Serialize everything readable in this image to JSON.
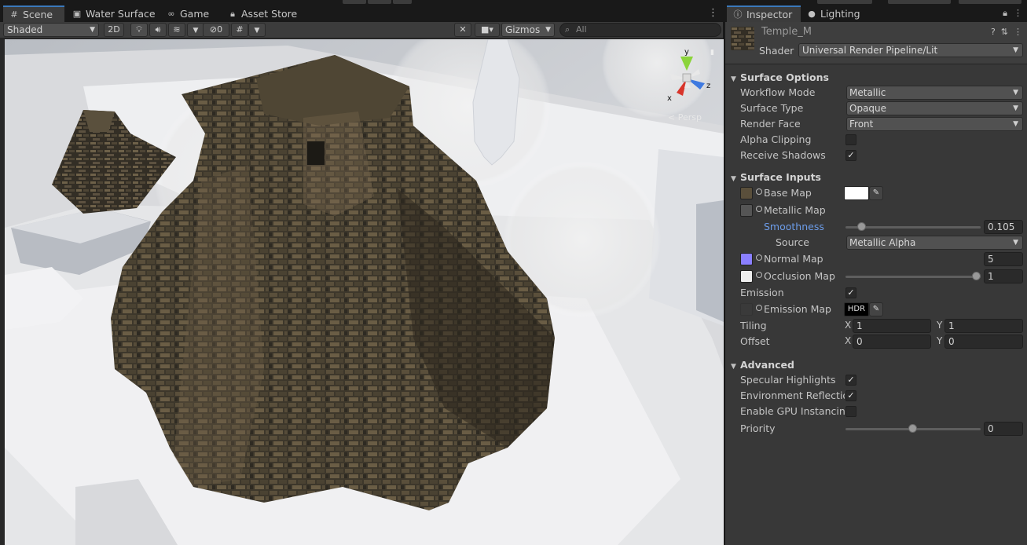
{
  "scene_window": {
    "tabs": [
      {
        "label": "Scene",
        "icon": "grid-icon",
        "active": true
      },
      {
        "label": "Water Surface",
        "icon": "water-surface-icon",
        "active": false
      },
      {
        "label": "Game",
        "icon": "game-controller-icon",
        "active": false
      },
      {
        "label": "Asset Store",
        "icon": "shopping-bag-icon",
        "active": false
      }
    ],
    "toolbar": {
      "draw_mode": "Shaded",
      "mode_2d": "2D",
      "hidden_count": "0",
      "gizmos_label": "Gizmos",
      "search_placeholder": "All"
    },
    "viewport": {
      "projection_label": "< Persp",
      "axis_labels": {
        "x": "x",
        "y": "y",
        "z": "z"
      }
    }
  },
  "inspector": {
    "tabs": [
      {
        "label": "Inspector",
        "icon": "info-icon",
        "active": true
      },
      {
        "label": "Lighting",
        "icon": "lightbulb-icon",
        "active": false
      }
    ],
    "material_name": "Temple_M",
    "shader_label": "Shader",
    "shader_value": "Universal Render Pipeline/Lit",
    "sections": {
      "surface_options": {
        "title": "Surface Options",
        "workflow_mode": {
          "label": "Workflow Mode",
          "value": "Metallic"
        },
        "surface_type": {
          "label": "Surface Type",
          "value": "Opaque"
        },
        "render_face": {
          "label": "Render Face",
          "value": "Front"
        },
        "alpha_clipping": {
          "label": "Alpha Clipping",
          "checked": false
        },
        "receive_shadows": {
          "label": "Receive Shadows",
          "checked": true
        }
      },
      "surface_inputs": {
        "title": "Surface Inputs",
        "base_map": {
          "label": "Base Map",
          "color": "#ffffff"
        },
        "metallic_map": {
          "label": "Metallic Map"
        },
        "smoothness": {
          "label": "Smoothness",
          "value": "0.105",
          "fraction": 0.105
        },
        "source": {
          "label": "Source",
          "value": "Metallic Alpha"
        },
        "normal_map": {
          "label": "Normal Map",
          "value": "5"
        },
        "occlusion_map": {
          "label": "Occlusion Map",
          "value": "1",
          "fraction": 1.0
        },
        "emission": {
          "label": "Emission",
          "checked": true
        },
        "emission_map": {
          "label": "Emission Map",
          "hdr": "HDR"
        },
        "tiling": {
          "label": "Tiling",
          "x_label": "X",
          "x": "1",
          "y_label": "Y",
          "y": "1"
        },
        "offset": {
          "label": "Offset",
          "x_label": "X",
          "x": "0",
          "y_label": "Y",
          "y": "0"
        }
      },
      "advanced": {
        "title": "Advanced",
        "specular_highlights": {
          "label": "Specular Highlights",
          "checked": true
        },
        "environment_reflections": {
          "label": "Environment Reflections",
          "checked": true
        },
        "gpu_instancing": {
          "label": "Enable GPU Instancing",
          "checked": false
        },
        "priority": {
          "label": "Priority",
          "value": "0",
          "fraction": 0.5
        }
      }
    }
  },
  "colors": {
    "accent_blue": "#3a79bb",
    "normal_map_swatch": "#8a7fff",
    "occlusion_swatch": "#eeeeee",
    "smoothness_label": "#6c9ce8"
  }
}
